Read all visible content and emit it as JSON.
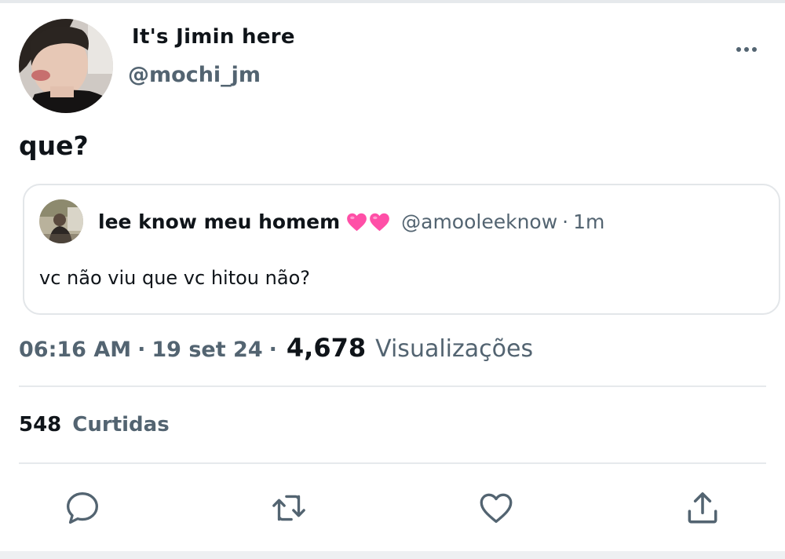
{
  "tweet": {
    "author": {
      "display_name": "It's Jimin here",
      "handle": "@mochi_jm",
      "avatar_icon": "profile-photo"
    },
    "text": "que?",
    "quoted": {
      "display_name": "lee know meu homem",
      "handle": "@amooleeknow",
      "separator": "·",
      "time": "1m",
      "text": "vc não viu que vc hitou não?",
      "heart_color": "#ff4fa7"
    },
    "meta": {
      "time": "06:16 AM",
      "separator": "·",
      "date": "19 set 24",
      "views_count": "4,678",
      "views_label": "Visualizações"
    },
    "stats": {
      "likes_count": "548",
      "likes_label": "Curtidas"
    },
    "actions": [
      "reply-icon",
      "retweet-icon",
      "like-icon",
      "share-icon"
    ]
  },
  "colors": {
    "primary_text": "#0f1419",
    "secondary_text": "#536471",
    "border": "#e6e9ec"
  }
}
